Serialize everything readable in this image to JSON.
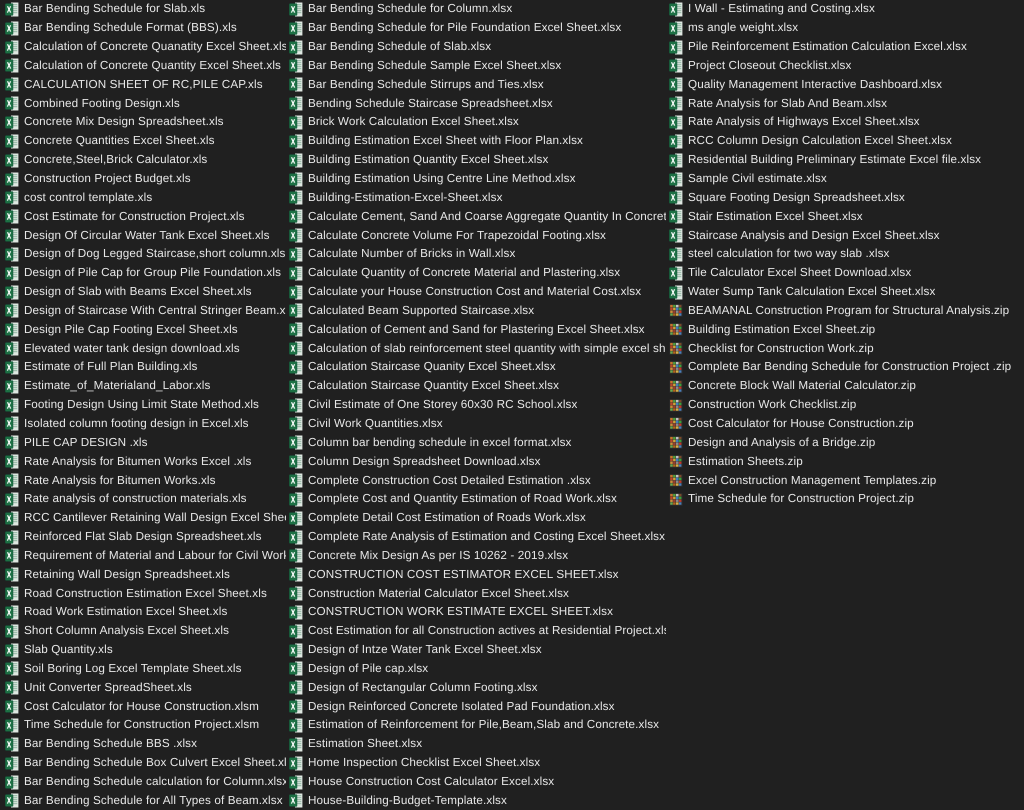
{
  "window": {
    "background_color": "#202020",
    "text_color": "#e8e8e8",
    "view": "list"
  },
  "icons": {
    "xls": {
      "name": "excel-xls-icon",
      "color": "#1d7044",
      "accent": "#e8e8e8"
    },
    "xlsm": {
      "name": "excel-xlsm-icon",
      "color": "#1d7044",
      "accent": "#e8e8e8"
    },
    "xlsx": {
      "name": "excel-xlsx-icon",
      "color": "#1d7044",
      "accent": "#e8e8e8"
    },
    "zip": {
      "name": "zip-archive-icon",
      "color": "#c26b2a",
      "accent": "#3aa03a"
    }
  },
  "columns": [
    {
      "id": "column-1",
      "files": [
        {
          "name": "Bar Bending Schedule for Slab.xls",
          "type": "xls"
        },
        {
          "name": "Bar Bending Schedule Format (BBS).xls",
          "type": "xls"
        },
        {
          "name": "Calculation of Concrete Quanatity Excel Sheet.xls",
          "type": "xls"
        },
        {
          "name": "Calculation of Concrete Quantity Excel Sheet.xls",
          "type": "xls"
        },
        {
          "name": "CALCULATION SHEET  OF RC,PILE CAP.xls",
          "type": "xls"
        },
        {
          "name": "Combined Footing Design.xls",
          "type": "xls"
        },
        {
          "name": "Concrete Mix Design Spreadsheet.xls",
          "type": "xls"
        },
        {
          "name": "Concrete Quantities Excel Sheet.xls",
          "type": "xls"
        },
        {
          "name": "Concrete,Steel,Brick Calculator.xls",
          "type": "xls"
        },
        {
          "name": "Construction Project Budget.xls",
          "type": "xls"
        },
        {
          "name": "cost control template.xls",
          "type": "xls"
        },
        {
          "name": "Cost Estimate for Construction Project.xls",
          "type": "xls"
        },
        {
          "name": "Design Of Circular Water Tank Excel Sheet.xls",
          "type": "xls"
        },
        {
          "name": "Design of Dog Legged Staircase,short column.xls",
          "type": "xls"
        },
        {
          "name": "Design of Pile Cap for Group Pile Foundation.xls",
          "type": "xls"
        },
        {
          "name": "Design of Slab with Beams Excel Sheet.xls",
          "type": "xls"
        },
        {
          "name": "Design of Staircase With Central Stringer Beam.xls",
          "type": "xls"
        },
        {
          "name": "Design Pile Cap Footing Excel Sheet.xls",
          "type": "xls"
        },
        {
          "name": "Elevated water tank design download.xls",
          "type": "xls"
        },
        {
          "name": "Estimate of Full Plan Building.xls",
          "type": "xls"
        },
        {
          "name": "Estimate_of_Materialand_Labor.xls",
          "type": "xls"
        },
        {
          "name": "Footing Design Using Limit State Method.xls",
          "type": "xls"
        },
        {
          "name": "Isolated column footing design in Excel.xls",
          "type": "xls"
        },
        {
          "name": "PILE CAP DESIGN .xls",
          "type": "xls"
        },
        {
          "name": "Rate Analysis for Bitumen Works Excel .xls",
          "type": "xls"
        },
        {
          "name": "Rate Analysis for Bitumen Works.xls",
          "type": "xls"
        },
        {
          "name": "Rate analysis of construction materials.xls",
          "type": "xls"
        },
        {
          "name": "RCC Cantilever Retaining Wall Design Excel Sheet.xls",
          "type": "xls"
        },
        {
          "name": "Reinforced Flat Slab Design Spreadsheet.xls",
          "type": "xls"
        },
        {
          "name": "Requirement of Material and Labour for Civil Work.xls",
          "type": "xls"
        },
        {
          "name": "Retaining Wall Design Spreadsheet.xls",
          "type": "xls"
        },
        {
          "name": "Road Construction Estimation Excel Sheet.xls",
          "type": "xls"
        },
        {
          "name": "Road Work Estimation Excel Sheet.xls",
          "type": "xls"
        },
        {
          "name": "Short Column Analysis Excel Sheet.xls",
          "type": "xls"
        },
        {
          "name": "Slab Quantity.xls",
          "type": "xls"
        },
        {
          "name": "Soil Boring Log Excel Template Sheet.xls",
          "type": "xls"
        },
        {
          "name": "Unit Converter SpreadSheet.xls",
          "type": "xls"
        },
        {
          "name": "Cost Calculator for House Construction.xlsm",
          "type": "xlsm"
        },
        {
          "name": "Time Schedule for Construction Project.xlsm",
          "type": "xlsm"
        },
        {
          "name": "Bar Bending Schedule BBS .xlsx",
          "type": "xlsx"
        },
        {
          "name": "Bar Bending Schedule Box Culvert Excel Sheet.xlsx",
          "type": "xlsx"
        },
        {
          "name": "Bar Bending Schedule calculation for Column.xlsx",
          "type": "xlsx"
        },
        {
          "name": "Bar Bending Schedule for All Types of Beam.xlsx",
          "type": "xlsx"
        }
      ]
    },
    {
      "id": "column-2",
      "files": [
        {
          "name": "Bar Bending Schedule for Column.xlsx",
          "type": "xlsx"
        },
        {
          "name": "Bar Bending Schedule for Pile Foundation Excel Sheet.xlsx",
          "type": "xlsx"
        },
        {
          "name": "Bar Bending Schedule of Slab.xlsx",
          "type": "xlsx"
        },
        {
          "name": "Bar Bending Schedule Sample Excel Sheet.xlsx",
          "type": "xlsx"
        },
        {
          "name": "Bar Bending Schedule Stirrups and Ties.xlsx",
          "type": "xlsx"
        },
        {
          "name": "Bending Schedule Staircase Spreadsheet.xlsx",
          "type": "xlsx"
        },
        {
          "name": "Brick Work Calculation Excel Sheet.xlsx",
          "type": "xlsx"
        },
        {
          "name": "Building Estimation Excel Sheet with Floor Plan.xlsx",
          "type": "xlsx"
        },
        {
          "name": "Building Estimation Quantity Excel Sheet.xlsx",
          "type": "xlsx"
        },
        {
          "name": "Building Estimation Using Centre Line Method.xlsx",
          "type": "xlsx"
        },
        {
          "name": "Building-Estimation-Excel-Sheet.xlsx",
          "type": "xlsx"
        },
        {
          "name": "Calculate Cement, Sand And Coarse Aggregate Quantity In Concrete.xlsx",
          "type": "xlsx"
        },
        {
          "name": "Calculate Concrete Volume For Trapezoidal Footing.xlsx",
          "type": "xlsx"
        },
        {
          "name": "Calculate Number of Bricks in Wall.xlsx",
          "type": "xlsx"
        },
        {
          "name": "Calculate Quantity of Concrete Material and Plastering.xlsx",
          "type": "xlsx"
        },
        {
          "name": "Calculate your House Construction Cost and Material Cost.xlsx",
          "type": "xlsx"
        },
        {
          "name": "Calculated Beam Supported Staircase.xlsx",
          "type": "xlsx"
        },
        {
          "name": "Calculation of Cement and Sand for Plastering Excel Sheet.xlsx",
          "type": "xlsx"
        },
        {
          "name": "Calculation of slab reinforcement steel quantity with simple excel sheet.xlsx",
          "type": "xlsx"
        },
        {
          "name": "Calculation Staircase Quanity Excel Sheet.xlsx",
          "type": "xlsx"
        },
        {
          "name": "Calculation Staircase Quantity Excel Sheet.xlsx",
          "type": "xlsx"
        },
        {
          "name": "Civil Estimate of One Storey 60x30 RC School.xlsx",
          "type": "xlsx"
        },
        {
          "name": "Civil Work Quantities.xlsx",
          "type": "xlsx"
        },
        {
          "name": "Column bar bending schedule in excel format.xlsx",
          "type": "xlsx"
        },
        {
          "name": "Column Design Spreadsheet Download.xlsx",
          "type": "xlsx"
        },
        {
          "name": "Complete Construction Cost Detailed Estimation .xlsx",
          "type": "xlsx"
        },
        {
          "name": "Complete Cost and Quantity Estimation of Road Work.xlsx",
          "type": "xlsx"
        },
        {
          "name": "Complete Detail Cost Estimation of Roads Work.xlsx",
          "type": "xlsx"
        },
        {
          "name": "Complete Rate Analysis of Estimation and Costing Excel Sheet.xlsx",
          "type": "xlsx"
        },
        {
          "name": "Concrete Mix Design As per IS 10262 - 2019.xlsx",
          "type": "xlsx"
        },
        {
          "name": "CONSTRUCTION COST ESTIMATOR EXCEL SHEET.xlsx",
          "type": "xlsx"
        },
        {
          "name": "Construction Material Calculator Excel Sheet.xlsx",
          "type": "xlsx"
        },
        {
          "name": "CONSTRUCTION WORK ESTIMATE EXCEL SHEET.xlsx",
          "type": "xlsx"
        },
        {
          "name": "Cost Estimation for all Construction actives at Residential Project.xlsx",
          "type": "xlsx"
        },
        {
          "name": "Design of Intze Water Tank Excel Sheet.xlsx",
          "type": "xlsx"
        },
        {
          "name": "Design of Pile cap.xlsx",
          "type": "xlsx"
        },
        {
          "name": "Design of Rectangular Column Footing.xlsx",
          "type": "xlsx"
        },
        {
          "name": "Design Reinforced Concrete Isolated Pad Foundation.xlsx",
          "type": "xlsx"
        },
        {
          "name": "Estimation of Reinforcement for  Pile,Beam,Slab and Concrete.xlsx",
          "type": "xlsx"
        },
        {
          "name": "Estimation Sheet.xlsx",
          "type": "xlsx"
        },
        {
          "name": "Home Inspection Checklist Excel Sheet.xlsx",
          "type": "xlsx"
        },
        {
          "name": "House Construction Cost Calculator Excel.xlsx",
          "type": "xlsx"
        },
        {
          "name": "House-Building-Budget-Template.xlsx",
          "type": "xlsx"
        }
      ]
    },
    {
      "id": "column-3",
      "files": [
        {
          "name": "I Wall - Estimating and Costing.xlsx",
          "type": "xlsx"
        },
        {
          "name": "ms angle weight.xlsx",
          "type": "xlsx"
        },
        {
          "name": "Pile Reinforcement Estimation Calculation Excel.xlsx",
          "type": "xlsx"
        },
        {
          "name": "Project Closeout Checklist.xlsx",
          "type": "xlsx"
        },
        {
          "name": "Quality Management Interactive Dashboard.xlsx",
          "type": "xlsx"
        },
        {
          "name": "Rate Analysis for Slab And Beam.xlsx",
          "type": "xlsx"
        },
        {
          "name": "Rate Analysis of Highways Excel Sheet.xlsx",
          "type": "xlsx"
        },
        {
          "name": "RCC Column Design Calculation Excel Sheet.xlsx",
          "type": "xlsx"
        },
        {
          "name": "Residential Building Preliminary Estimate Excel file.xlsx",
          "type": "xlsx"
        },
        {
          "name": "Sample Civil estimate.xlsx",
          "type": "xlsx"
        },
        {
          "name": "Square Footing Design Spreadsheet.xlsx",
          "type": "xlsx"
        },
        {
          "name": "Stair Estimation Excel Sheet.xlsx",
          "type": "xlsx"
        },
        {
          "name": "Staircase Analysis and Design Excel Sheet.xlsx",
          "type": "xlsx"
        },
        {
          "name": "steel calculation for two way slab .xlsx",
          "type": "xlsx"
        },
        {
          "name": "Tile Calculator Excel Sheet Download.xlsx",
          "type": "xlsx"
        },
        {
          "name": "Water Sump Tank Calculation Excel Sheet.xlsx",
          "type": "xlsx"
        },
        {
          "name": "BEAMANAL Construction Program for Structural Analysis.zip",
          "type": "zip"
        },
        {
          "name": "Building Estimation Excel Sheet.zip",
          "type": "zip"
        },
        {
          "name": "Checklist for Construction Work.zip",
          "type": "zip"
        },
        {
          "name": "Complete Bar Bending Schedule for Construction Project .zip",
          "type": "zip"
        },
        {
          "name": "Concrete Block Wall Material Calculator.zip",
          "type": "zip"
        },
        {
          "name": "Construction Work Checklist.zip",
          "type": "zip"
        },
        {
          "name": "Cost Calculator for House Construction.zip",
          "type": "zip"
        },
        {
          "name": "Design and Analysis of a Bridge.zip",
          "type": "zip"
        },
        {
          "name": "Estimation Sheets.zip",
          "type": "zip"
        },
        {
          "name": "Excel Construction Management Templates.zip",
          "type": "zip"
        },
        {
          "name": "Time Schedule for Construction Project.zip",
          "type": "zip"
        }
      ]
    }
  ]
}
